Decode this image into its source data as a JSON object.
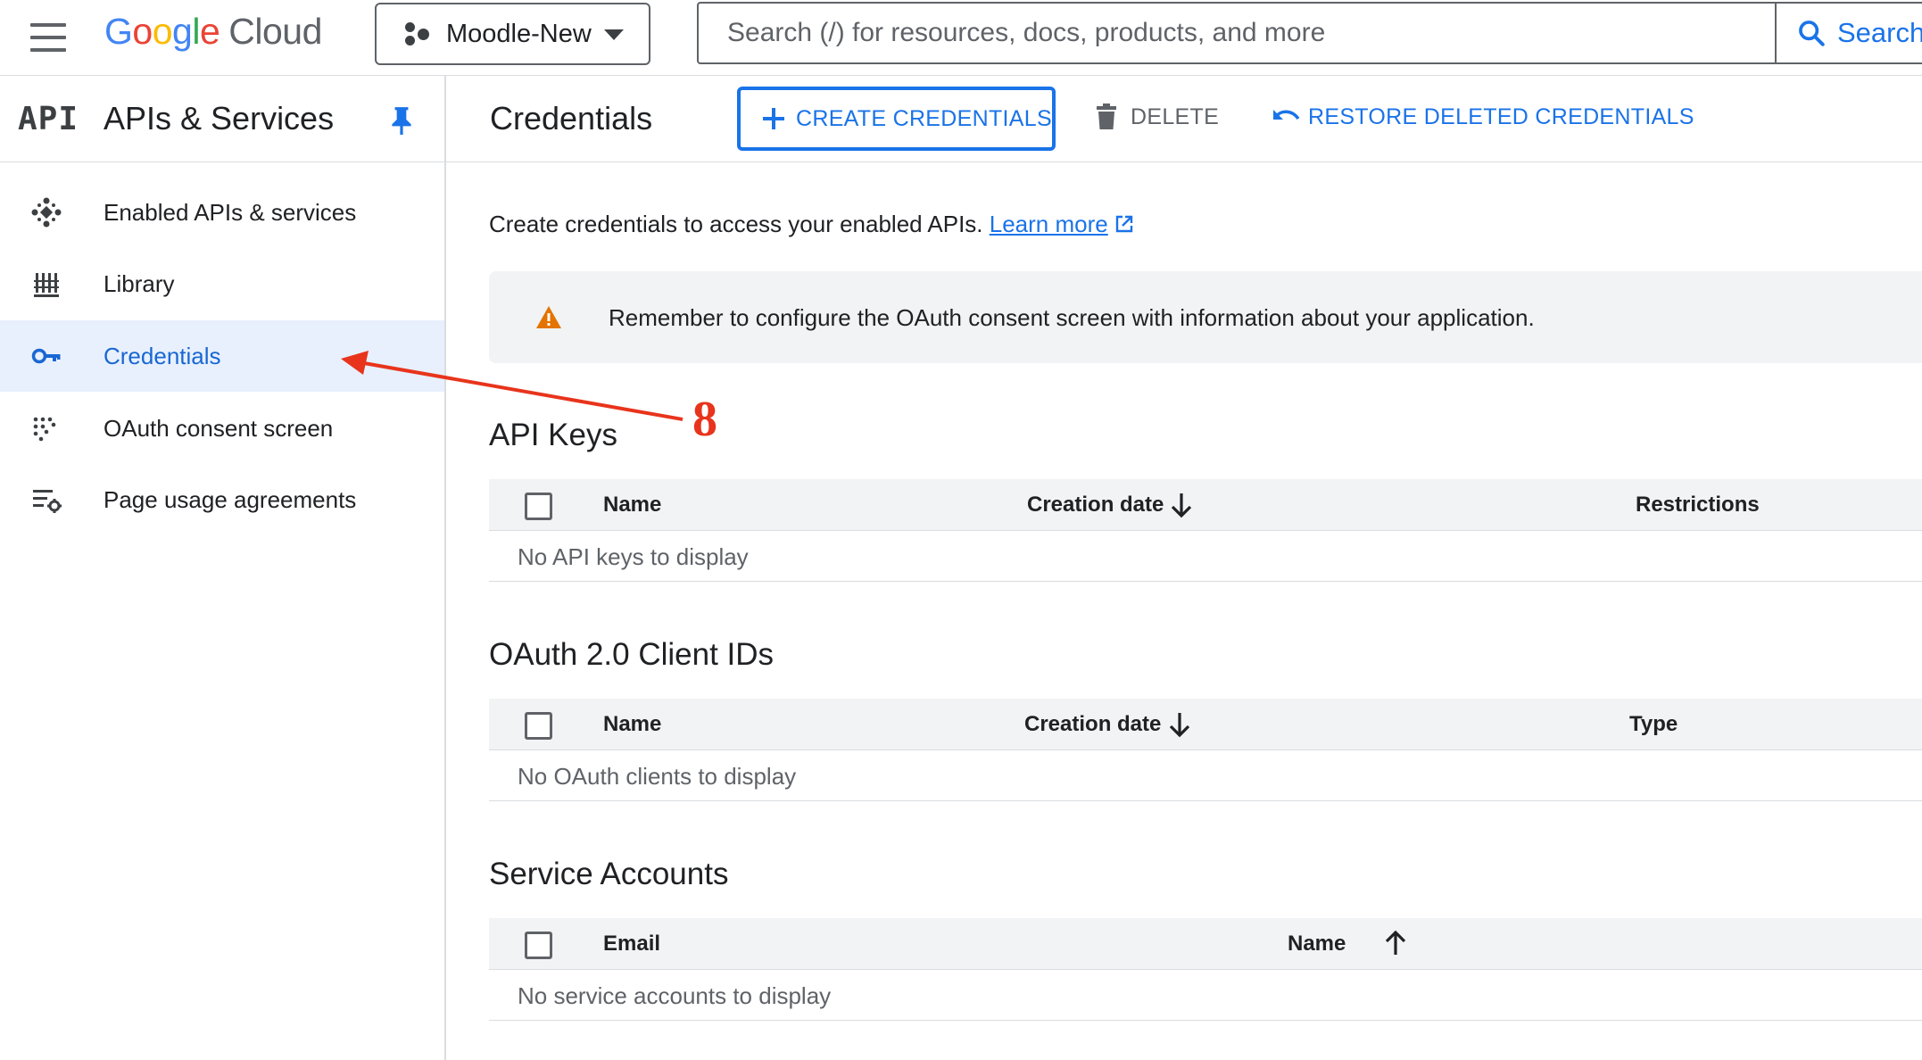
{
  "header": {
    "logo": {
      "g1": "G",
      "o1": "o",
      "o2": "o",
      "g2": "g",
      "l": "l",
      "e": "e",
      "cloud": "Cloud"
    },
    "project_name": "Moodle-New",
    "search_placeholder": "Search (/) for resources, docs, products, and more",
    "search_button_label": "Search"
  },
  "sidebar": {
    "api_mark": "API",
    "title": "APIs & Services",
    "items": [
      {
        "label": "Enabled APIs & services",
        "icon": "diamond-dots-icon",
        "active": false
      },
      {
        "label": "Library",
        "icon": "library-icon",
        "active": false
      },
      {
        "label": "Credentials",
        "icon": "key-icon",
        "active": true
      },
      {
        "label": "OAuth consent screen",
        "icon": "consent-dots-icon",
        "active": false
      },
      {
        "label": "Page usage agreements",
        "icon": "settings-list-icon",
        "active": false
      }
    ]
  },
  "toolbar": {
    "title": "Credentials",
    "create_label": "CREATE CREDENTIALS",
    "delete_label": "DELETE",
    "restore_label": "RESTORE DELETED CREDENTIALS"
  },
  "main": {
    "intro_text": "Create credentials to access your enabled APIs.",
    "learn_more": "Learn more",
    "banner_text": "Remember to configure the OAuth consent screen with information about your application.",
    "api_keys": {
      "title": "API Keys",
      "columns": [
        "Name",
        "Creation date",
        "Restrictions"
      ],
      "empty": "No API keys to display"
    },
    "oauth": {
      "title": "OAuth 2.0 Client IDs",
      "columns": [
        "Name",
        "Creation date",
        "Type"
      ],
      "empty": "No OAuth clients to display"
    },
    "service_accounts": {
      "title": "Service Accounts",
      "columns": [
        "Email",
        "Name"
      ],
      "empty": "No service accounts to display"
    }
  },
  "annotation": {
    "step_number": "8",
    "color": "#e8341c"
  },
  "colors": {
    "accent": "#1a73e8",
    "active_bg": "#e8f0fe",
    "warning": "#e37400"
  }
}
